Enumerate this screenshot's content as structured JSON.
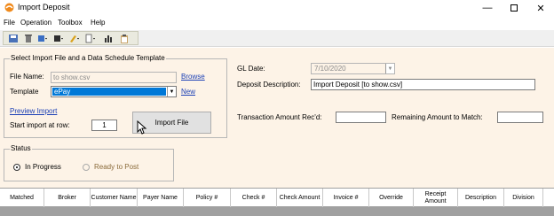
{
  "window": {
    "title": "Import Deposit"
  },
  "menu": [
    "File",
    "Operation",
    "Toolbox",
    "Help"
  ],
  "toolbar": {
    "icons": [
      "save-icon",
      "delete-icon",
      "edit-dropdown-icon",
      "list-dropdown-icon",
      "pen-dropdown-icon",
      "document-dropdown-icon",
      "chart-icon",
      "clipboard-icon"
    ]
  },
  "import_group": {
    "legend": "Select Import File and a Data Schedule Template",
    "file_name_label": "File Name:",
    "file_name_value": "to show.csv",
    "browse_link": "Browse",
    "template_label": "Template",
    "template_value": "ePay",
    "new_link": "New",
    "preview_link": "Preview Import",
    "start_row_label": "Start import at row:",
    "start_row_value": "1",
    "import_button": "Import File"
  },
  "right_panel": {
    "gl_date_label": "GL Date:",
    "gl_date_value": "7/10/2020",
    "deposit_desc_label": "Deposit Description:",
    "deposit_desc_value": "Import Deposit [to show.csv]",
    "txn_amount_label": "Transaction Amount Rec'd:",
    "txn_amount_value": "",
    "remaining_label": "Remaining Amount to Match:",
    "remaining_value": ""
  },
  "status_group": {
    "legend": "Status",
    "options": [
      {
        "label": "In Progress",
        "selected": true
      },
      {
        "label": "Ready to Post",
        "selected": false
      }
    ]
  },
  "grid": {
    "columns": [
      "Matched",
      "Broker",
      "Customer Name",
      "Payer Name",
      "Policy #",
      "Check #",
      "Check Amount",
      "Invoice #",
      "Override",
      "Receipt Amount",
      "Description",
      "Division"
    ]
  },
  "colors": {
    "form_background": "#fdf3e7",
    "link": "#1a3fb5",
    "selection": "#0078d7"
  }
}
